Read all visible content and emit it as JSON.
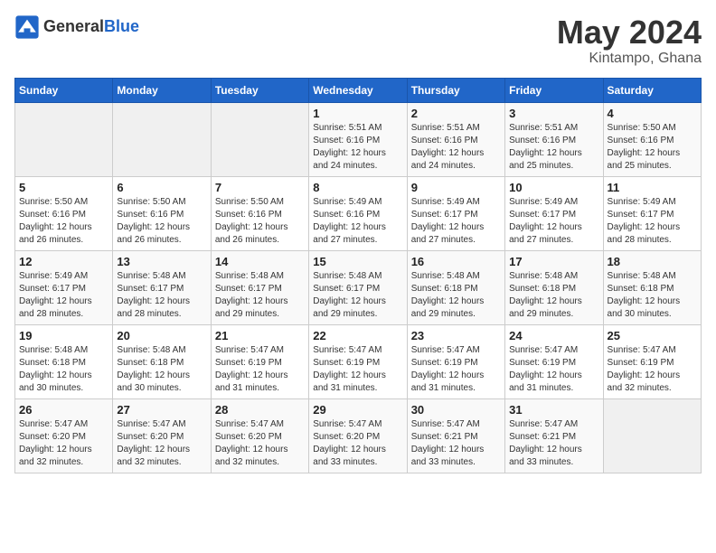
{
  "logo": {
    "general": "General",
    "blue": "Blue"
  },
  "title": "May 2024",
  "subtitle": "Kintampo, Ghana",
  "headers": [
    "Sunday",
    "Monday",
    "Tuesday",
    "Wednesday",
    "Thursday",
    "Friday",
    "Saturday"
  ],
  "weeks": [
    [
      {
        "day": "",
        "info": ""
      },
      {
        "day": "",
        "info": ""
      },
      {
        "day": "",
        "info": ""
      },
      {
        "day": "1",
        "info": "Sunrise: 5:51 AM\nSunset: 6:16 PM\nDaylight: 12 hours\nand 24 minutes."
      },
      {
        "day": "2",
        "info": "Sunrise: 5:51 AM\nSunset: 6:16 PM\nDaylight: 12 hours\nand 24 minutes."
      },
      {
        "day": "3",
        "info": "Sunrise: 5:51 AM\nSunset: 6:16 PM\nDaylight: 12 hours\nand 25 minutes."
      },
      {
        "day": "4",
        "info": "Sunrise: 5:50 AM\nSunset: 6:16 PM\nDaylight: 12 hours\nand 25 minutes."
      }
    ],
    [
      {
        "day": "5",
        "info": "Sunrise: 5:50 AM\nSunset: 6:16 PM\nDaylight: 12 hours\nand 26 minutes."
      },
      {
        "day": "6",
        "info": "Sunrise: 5:50 AM\nSunset: 6:16 PM\nDaylight: 12 hours\nand 26 minutes."
      },
      {
        "day": "7",
        "info": "Sunrise: 5:50 AM\nSunset: 6:16 PM\nDaylight: 12 hours\nand 26 minutes."
      },
      {
        "day": "8",
        "info": "Sunrise: 5:49 AM\nSunset: 6:16 PM\nDaylight: 12 hours\nand 27 minutes."
      },
      {
        "day": "9",
        "info": "Sunrise: 5:49 AM\nSunset: 6:17 PM\nDaylight: 12 hours\nand 27 minutes."
      },
      {
        "day": "10",
        "info": "Sunrise: 5:49 AM\nSunset: 6:17 PM\nDaylight: 12 hours\nand 27 minutes."
      },
      {
        "day": "11",
        "info": "Sunrise: 5:49 AM\nSunset: 6:17 PM\nDaylight: 12 hours\nand 28 minutes."
      }
    ],
    [
      {
        "day": "12",
        "info": "Sunrise: 5:49 AM\nSunset: 6:17 PM\nDaylight: 12 hours\nand 28 minutes."
      },
      {
        "day": "13",
        "info": "Sunrise: 5:48 AM\nSunset: 6:17 PM\nDaylight: 12 hours\nand 28 minutes."
      },
      {
        "day": "14",
        "info": "Sunrise: 5:48 AM\nSunset: 6:17 PM\nDaylight: 12 hours\nand 29 minutes."
      },
      {
        "day": "15",
        "info": "Sunrise: 5:48 AM\nSunset: 6:17 PM\nDaylight: 12 hours\nand 29 minutes."
      },
      {
        "day": "16",
        "info": "Sunrise: 5:48 AM\nSunset: 6:18 PM\nDaylight: 12 hours\nand 29 minutes."
      },
      {
        "day": "17",
        "info": "Sunrise: 5:48 AM\nSunset: 6:18 PM\nDaylight: 12 hours\nand 29 minutes."
      },
      {
        "day": "18",
        "info": "Sunrise: 5:48 AM\nSunset: 6:18 PM\nDaylight: 12 hours\nand 30 minutes."
      }
    ],
    [
      {
        "day": "19",
        "info": "Sunrise: 5:48 AM\nSunset: 6:18 PM\nDaylight: 12 hours\nand 30 minutes."
      },
      {
        "day": "20",
        "info": "Sunrise: 5:48 AM\nSunset: 6:18 PM\nDaylight: 12 hours\nand 30 minutes."
      },
      {
        "day": "21",
        "info": "Sunrise: 5:47 AM\nSunset: 6:19 PM\nDaylight: 12 hours\nand 31 minutes."
      },
      {
        "day": "22",
        "info": "Sunrise: 5:47 AM\nSunset: 6:19 PM\nDaylight: 12 hours\nand 31 minutes."
      },
      {
        "day": "23",
        "info": "Sunrise: 5:47 AM\nSunset: 6:19 PM\nDaylight: 12 hours\nand 31 minutes."
      },
      {
        "day": "24",
        "info": "Sunrise: 5:47 AM\nSunset: 6:19 PM\nDaylight: 12 hours\nand 31 minutes."
      },
      {
        "day": "25",
        "info": "Sunrise: 5:47 AM\nSunset: 6:19 PM\nDaylight: 12 hours\nand 32 minutes."
      }
    ],
    [
      {
        "day": "26",
        "info": "Sunrise: 5:47 AM\nSunset: 6:20 PM\nDaylight: 12 hours\nand 32 minutes."
      },
      {
        "day": "27",
        "info": "Sunrise: 5:47 AM\nSunset: 6:20 PM\nDaylight: 12 hours\nand 32 minutes."
      },
      {
        "day": "28",
        "info": "Sunrise: 5:47 AM\nSunset: 6:20 PM\nDaylight: 12 hours\nand 32 minutes."
      },
      {
        "day": "29",
        "info": "Sunrise: 5:47 AM\nSunset: 6:20 PM\nDaylight: 12 hours\nand 33 minutes."
      },
      {
        "day": "30",
        "info": "Sunrise: 5:47 AM\nSunset: 6:21 PM\nDaylight: 12 hours\nand 33 minutes."
      },
      {
        "day": "31",
        "info": "Sunrise: 5:47 AM\nSunset: 6:21 PM\nDaylight: 12 hours\nand 33 minutes."
      },
      {
        "day": "",
        "info": ""
      }
    ]
  ]
}
